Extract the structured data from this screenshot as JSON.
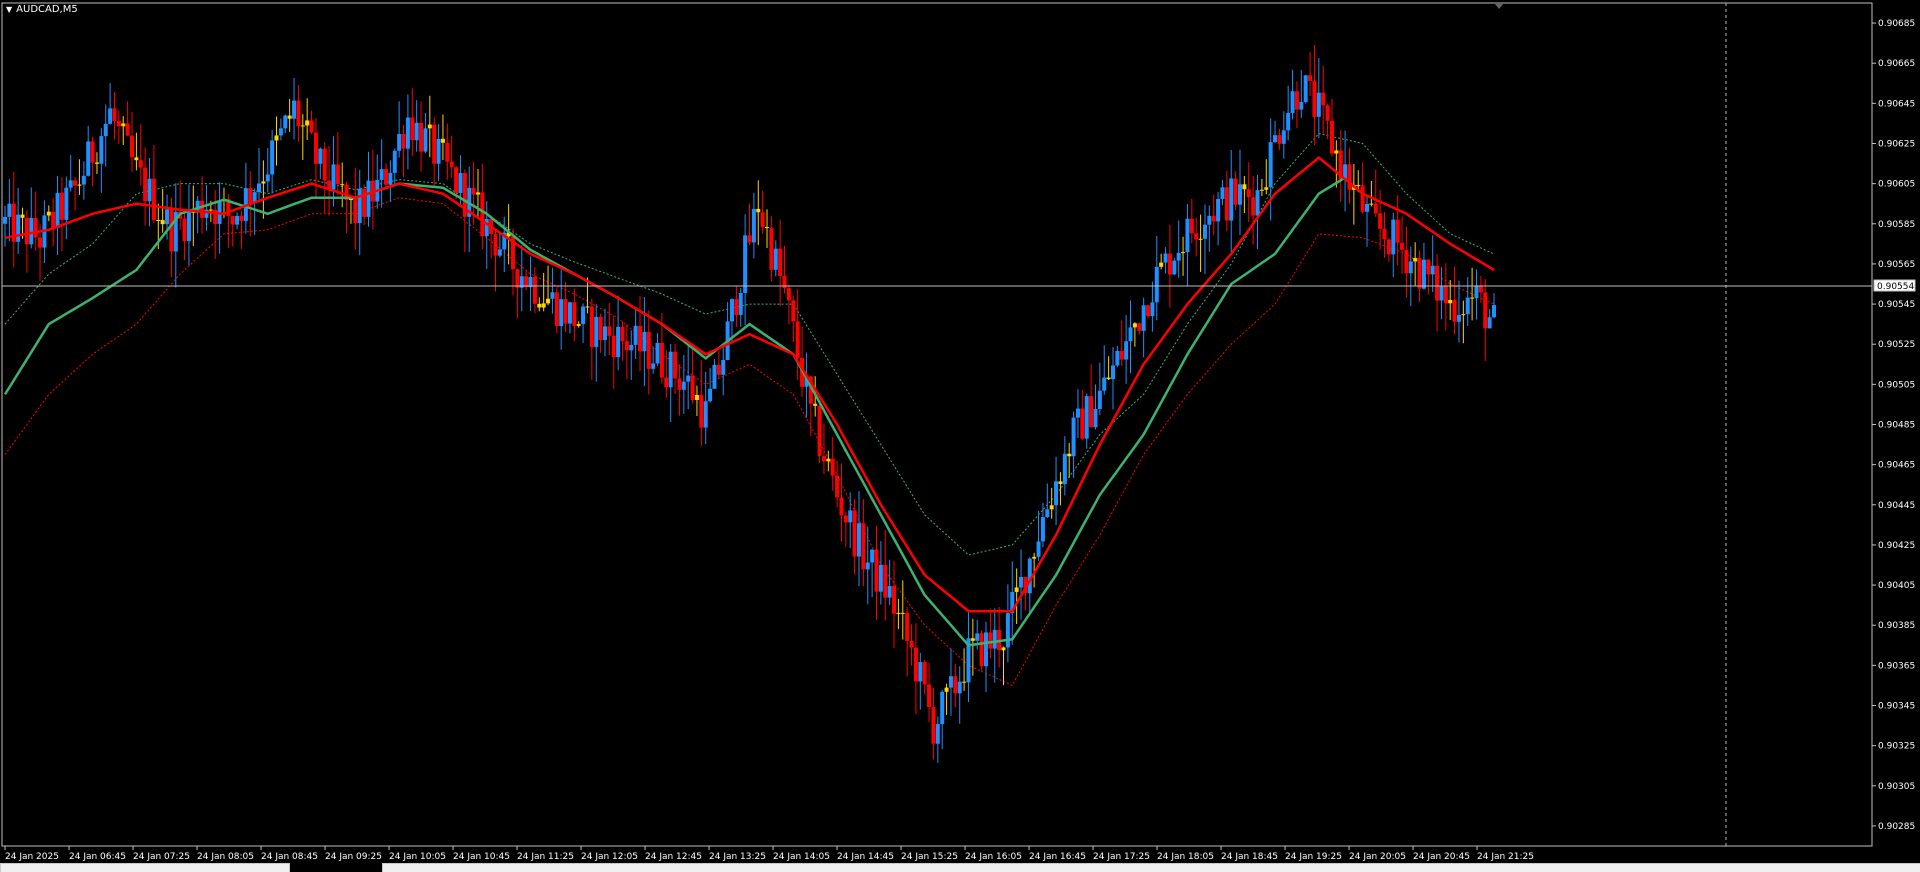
{
  "window": {
    "title": "AUDCAD,M5"
  },
  "current_price_label": "0.90554",
  "colors": {
    "background": "#000000",
    "bull_candle": "#1e90ff",
    "bear_candle": "#ff0000",
    "doji_candle": "#ffd700",
    "axis": "#c0c0c0",
    "ema_fast": "#ff0000",
    "ema_slow": "#3cb371",
    "band": "#ff0000",
    "band_upper": "#3cb371"
  },
  "chart_data": {
    "type": "candlestick",
    "symbol": "AUDCAD",
    "timeframe": "M5",
    "ylim": [
      0.90275,
      0.90695
    ],
    "y_ticks": [
      "0.90685",
      "0.90665",
      "0.90645",
      "0.90625",
      "0.90605",
      "0.90585",
      "0.90565",
      "0.90545",
      "0.90525",
      "0.90505",
      "0.90485",
      "0.90465",
      "0.90445",
      "0.90425",
      "0.90405",
      "0.90385",
      "0.90365",
      "0.90345",
      "0.90325",
      "0.90305",
      "0.90285"
    ],
    "x_ticks": [
      "24 Jan 2025",
      "24 Jan 06:45",
      "24 Jan 07:25",
      "24 Jan 08:05",
      "24 Jan 08:45",
      "24 Jan 09:25",
      "24 Jan 10:05",
      "24 Jan 10:45",
      "24 Jan 11:25",
      "24 Jan 12:05",
      "24 Jan 12:45",
      "24 Jan 13:25",
      "24 Jan 14:05",
      "24 Jan 14:45",
      "24 Jan 15:25",
      "24 Jan 16:05",
      "24 Jan 16:45",
      "24 Jan 17:25",
      "24 Jan 18:05",
      "24 Jan 18:45",
      "24 Jan 19:25",
      "24 Jan 20:05",
      "24 Jan 20:45",
      "24 Jan 21:25"
    ],
    "current_price": 0.90554,
    "close_path": [
      [
        0,
        0.90585
      ],
      [
        8,
        0.90578
      ],
      [
        16,
        0.90602
      ],
      [
        24,
        0.9064
      ],
      [
        30,
        0.9061
      ],
      [
        38,
        0.90582
      ],
      [
        46,
        0.90596
      ],
      [
        52,
        0.90588
      ],
      [
        60,
        0.90615
      ],
      [
        66,
        0.90642
      ],
      [
        72,
        0.90612
      ],
      [
        80,
        0.9059
      ],
      [
        86,
        0.90605
      ],
      [
        92,
        0.90638
      ],
      [
        100,
        0.90615
      ],
      [
        108,
        0.9059
      ],
      [
        116,
        0.90565
      ],
      [
        124,
        0.90548
      ],
      [
        132,
        0.90535
      ],
      [
        140,
        0.90528
      ],
      [
        148,
        0.9052
      ],
      [
        156,
        0.90505
      ],
      [
        160,
        0.9049
      ],
      [
        164,
        0.9052
      ],
      [
        168,
        0.9056
      ],
      [
        172,
        0.90595
      ],
      [
        178,
        0.9055
      ],
      [
        184,
        0.9049
      ],
      [
        190,
        0.9045
      ],
      [
        196,
        0.9042
      ],
      [
        202,
        0.904
      ],
      [
        208,
        0.90365
      ],
      [
        212,
        0.90335
      ],
      [
        216,
        0.9035
      ],
      [
        220,
        0.9037
      ],
      [
        228,
        0.9038
      ],
      [
        232,
        0.90405
      ],
      [
        238,
        0.90445
      ],
      [
        244,
        0.9048
      ],
      [
        250,
        0.905
      ],
      [
        256,
        0.90525
      ],
      [
        262,
        0.90555
      ],
      [
        268,
        0.90575
      ],
      [
        274,
        0.9059
      ],
      [
        280,
        0.90598
      ],
      [
        286,
        0.906
      ],
      [
        292,
        0.9064
      ],
      [
        296,
        0.90655
      ],
      [
        300,
        0.9064
      ],
      [
        306,
        0.9061
      ],
      [
        312,
        0.90585
      ],
      [
        318,
        0.90575
      ],
      [
        324,
        0.9056
      ],
      [
        330,
        0.90545
      ],
      [
        336,
        0.90548
      ],
      [
        340,
        0.90535
      ]
    ],
    "ema_fast_path": [
      [
        0,
        0.90578
      ],
      [
        10,
        0.90582
      ],
      [
        20,
        0.9059
      ],
      [
        30,
        0.90595
      ],
      [
        40,
        0.90592
      ],
      [
        50,
        0.9059
      ],
      [
        60,
        0.90598
      ],
      [
        70,
        0.90605
      ],
      [
        80,
        0.90598
      ],
      [
        90,
        0.90605
      ],
      [
        100,
        0.906
      ],
      [
        110,
        0.90585
      ],
      [
        120,
        0.9057
      ],
      [
        130,
        0.9056
      ],
      [
        140,
        0.90548
      ],
      [
        150,
        0.90535
      ],
      [
        160,
        0.9052
      ],
      [
        170,
        0.9053
      ],
      [
        180,
        0.9052
      ],
      [
        190,
        0.90485
      ],
      [
        200,
        0.90445
      ],
      [
        210,
        0.9041
      ],
      [
        220,
        0.90392
      ],
      [
        230,
        0.90392
      ],
      [
        240,
        0.9043
      ],
      [
        250,
        0.90475
      ],
      [
        260,
        0.90515
      ],
      [
        270,
        0.90545
      ],
      [
        280,
        0.9057
      ],
      [
        290,
        0.906
      ],
      [
        300,
        0.90618
      ],
      [
        310,
        0.906
      ],
      [
        320,
        0.9059
      ],
      [
        330,
        0.90575
      ],
      [
        340,
        0.90562
      ]
    ],
    "ema_slow_path": [
      [
        0,
        0.905
      ],
      [
        10,
        0.90535
      ],
      [
        20,
        0.90548
      ],
      [
        30,
        0.90562
      ],
      [
        40,
        0.9059
      ],
      [
        50,
        0.90597
      ],
      [
        60,
        0.9059
      ],
      [
        70,
        0.90598
      ],
      [
        80,
        0.90598
      ],
      [
        90,
        0.90605
      ],
      [
        100,
        0.90603
      ],
      [
        110,
        0.9059
      ],
      [
        120,
        0.90572
      ],
      [
        130,
        0.9056
      ],
      [
        140,
        0.90548
      ],
      [
        150,
        0.90535
      ],
      [
        160,
        0.90518
      ],
      [
        170,
        0.90535
      ],
      [
        180,
        0.9052
      ],
      [
        190,
        0.9048
      ],
      [
        200,
        0.9044
      ],
      [
        210,
        0.904
      ],
      [
        220,
        0.90375
      ],
      [
        230,
        0.90378
      ],
      [
        240,
        0.9041
      ],
      [
        250,
        0.9045
      ],
      [
        260,
        0.9048
      ],
      [
        270,
        0.9052
      ],
      [
        280,
        0.90555
      ],
      [
        290,
        0.9057
      ],
      [
        300,
        0.906
      ],
      [
        306,
        0.90608
      ]
    ],
    "band_upper_path": [
      [
        0,
        0.90535
      ],
      [
        10,
        0.9056
      ],
      [
        20,
        0.90575
      ],
      [
        30,
        0.906
      ],
      [
        40,
        0.90605
      ],
      [
        50,
        0.90605
      ],
      [
        60,
        0.906
      ],
      [
        70,
        0.90607
      ],
      [
        80,
        0.90602
      ],
      [
        90,
        0.90607
      ],
      [
        100,
        0.90605
      ],
      [
        110,
        0.9059
      ],
      [
        120,
        0.90575
      ],
      [
        130,
        0.90566
      ],
      [
        140,
        0.90558
      ],
      [
        150,
        0.9055
      ],
      [
        160,
        0.9054
      ],
      [
        170,
        0.90545
      ],
      [
        180,
        0.90545
      ],
      [
        190,
        0.9051
      ],
      [
        200,
        0.90475
      ],
      [
        210,
        0.9044
      ],
      [
        220,
        0.9042
      ],
      [
        230,
        0.90425
      ],
      [
        240,
        0.9045
      ],
      [
        250,
        0.9048
      ],
      [
        260,
        0.905
      ],
      [
        270,
        0.90535
      ],
      [
        280,
        0.90565
      ],
      [
        290,
        0.90605
      ],
      [
        300,
        0.9063
      ],
      [
        310,
        0.90625
      ],
      [
        320,
        0.906
      ],
      [
        330,
        0.9058
      ],
      [
        340,
        0.9057
      ]
    ],
    "band_lower_path": [
      [
        0,
        0.9047
      ],
      [
        10,
        0.905
      ],
      [
        20,
        0.9052
      ],
      [
        30,
        0.90535
      ],
      [
        40,
        0.9056
      ],
      [
        50,
        0.9058
      ],
      [
        60,
        0.90582
      ],
      [
        70,
        0.9059
      ],
      [
        80,
        0.9059
      ],
      [
        90,
        0.90598
      ],
      [
        100,
        0.90595
      ],
      [
        110,
        0.90578
      ],
      [
        120,
        0.9056
      ],
      [
        130,
        0.9055
      ],
      [
        140,
        0.90538
      ],
      [
        150,
        0.9052
      ],
      [
        160,
        0.90505
      ],
      [
        170,
        0.90515
      ],
      [
        180,
        0.905
      ],
      [
        190,
        0.9046
      ],
      [
        200,
        0.90415
      ],
      [
        210,
        0.90385
      ],
      [
        220,
        0.90365
      ],
      [
        230,
        0.90355
      ],
      [
        240,
        0.90395
      ],
      [
        250,
        0.9043
      ],
      [
        260,
        0.9047
      ],
      [
        270,
        0.905
      ],
      [
        280,
        0.90525
      ],
      [
        290,
        0.90545
      ],
      [
        300,
        0.9058
      ],
      [
        310,
        0.90578
      ],
      [
        320,
        0.9057
      ],
      [
        330,
        0.90555
      ],
      [
        340,
        0.90545
      ]
    ]
  }
}
